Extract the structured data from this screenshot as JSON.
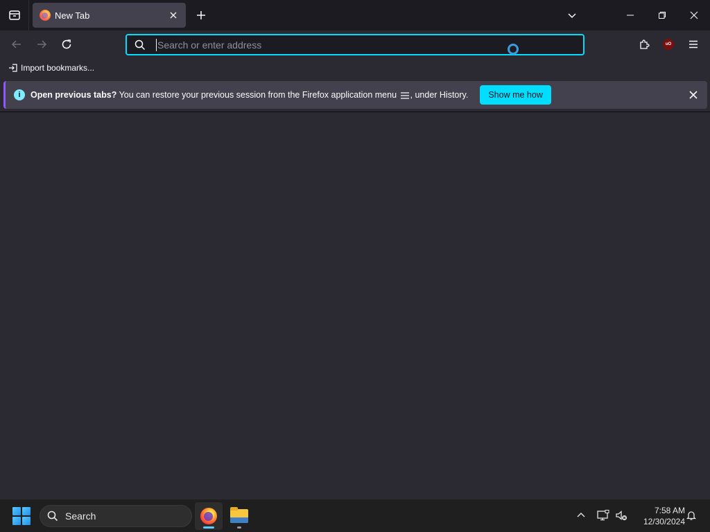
{
  "tab": {
    "title": "New Tab",
    "close_symbol": "✕"
  },
  "urlbar": {
    "placeholder": "Search or enter address",
    "value": ""
  },
  "bookmarks": {
    "import_label": "Import bookmarks..."
  },
  "notification": {
    "bold_text": "Open previous tabs?",
    "text_before_icon": " You can restore your previous session from the Firefox application menu ",
    "text_after_icon": ", under History.",
    "button_label": "Show me how",
    "info_symbol": "i"
  },
  "toolbar": {
    "ublock_label": "uO"
  },
  "taskbar": {
    "search_label": "Search",
    "time": "7:58 AM",
    "date": "12/30/2024"
  },
  "colors": {
    "accent": "#00ddff",
    "toolbar": "#2b2a33",
    "tab_active": "#42414d",
    "chrome_dark": "#1c1b22"
  },
  "icons": [
    "tabs-list-icon",
    "firefox-favicon",
    "close-icon",
    "plus-icon",
    "chevron-down-icon",
    "minimize-icon",
    "restore-icon",
    "back-arrow-icon",
    "forward-arrow-icon",
    "reload-icon",
    "search-icon",
    "extensions-icon",
    "ublock-icon",
    "hamburger-menu-icon",
    "import-icon",
    "info-icon",
    "start-logo-icon",
    "firefox-icon",
    "file-explorer-icon",
    "tray-chevron-up-icon",
    "network-icon",
    "volume-icon",
    "notification-bell-icon"
  ]
}
